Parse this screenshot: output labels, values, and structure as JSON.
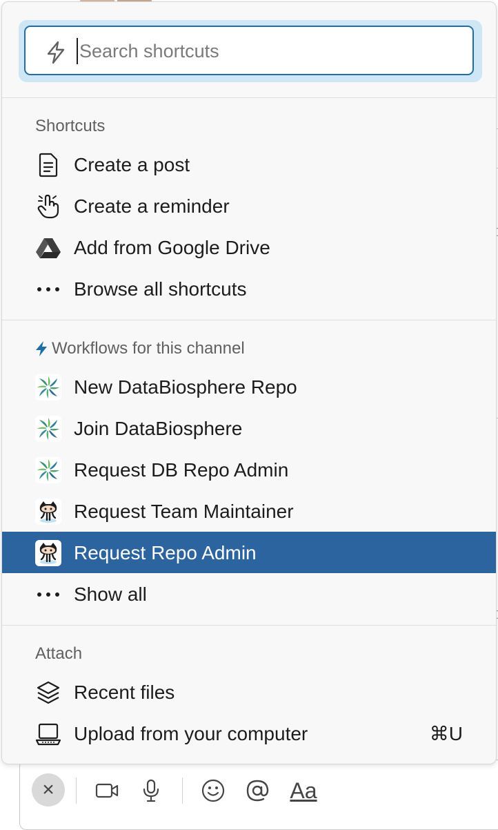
{
  "search": {
    "placeholder": "Search shortcuts",
    "value": ""
  },
  "sections": {
    "shortcuts": {
      "title": "Shortcuts",
      "items": [
        {
          "label": "Create a post",
          "icon": "document-icon"
        },
        {
          "label": "Create a reminder",
          "icon": "hand-pointer-icon"
        },
        {
          "label": "Add from Google Drive",
          "icon": "google-drive-icon"
        },
        {
          "label": "Browse all shortcuts",
          "icon": "more-dots-icon"
        }
      ]
    },
    "workflows": {
      "title": "Workflows for this channel",
      "items": [
        {
          "label": "New DataBiosphere Repo",
          "icon": "databiosphere-icon"
        },
        {
          "label": "Join DataBiosphere",
          "icon": "databiosphere-icon"
        },
        {
          "label": "Request DB Repo Admin",
          "icon": "databiosphere-icon"
        },
        {
          "label": "Request Team Maintainer",
          "icon": "github-octocat-icon"
        },
        {
          "label": "Request Repo Admin",
          "icon": "github-octocat-icon",
          "selected": true
        },
        {
          "label": "Show all",
          "icon": "more-dots-icon"
        }
      ]
    },
    "attach": {
      "title": "Attach",
      "items": [
        {
          "label": "Recent files",
          "icon": "layers-icon"
        },
        {
          "label": "Upload from your computer",
          "icon": "laptop-icon",
          "shortcut": "⌘U"
        }
      ]
    }
  },
  "toolbar": {
    "close_symbol": "×",
    "format_label": "Aa"
  },
  "colors": {
    "selected_bg": "#2c64a0",
    "focus_border": "#1d6fa3",
    "bolt_accent": "#1d6fa3"
  }
}
